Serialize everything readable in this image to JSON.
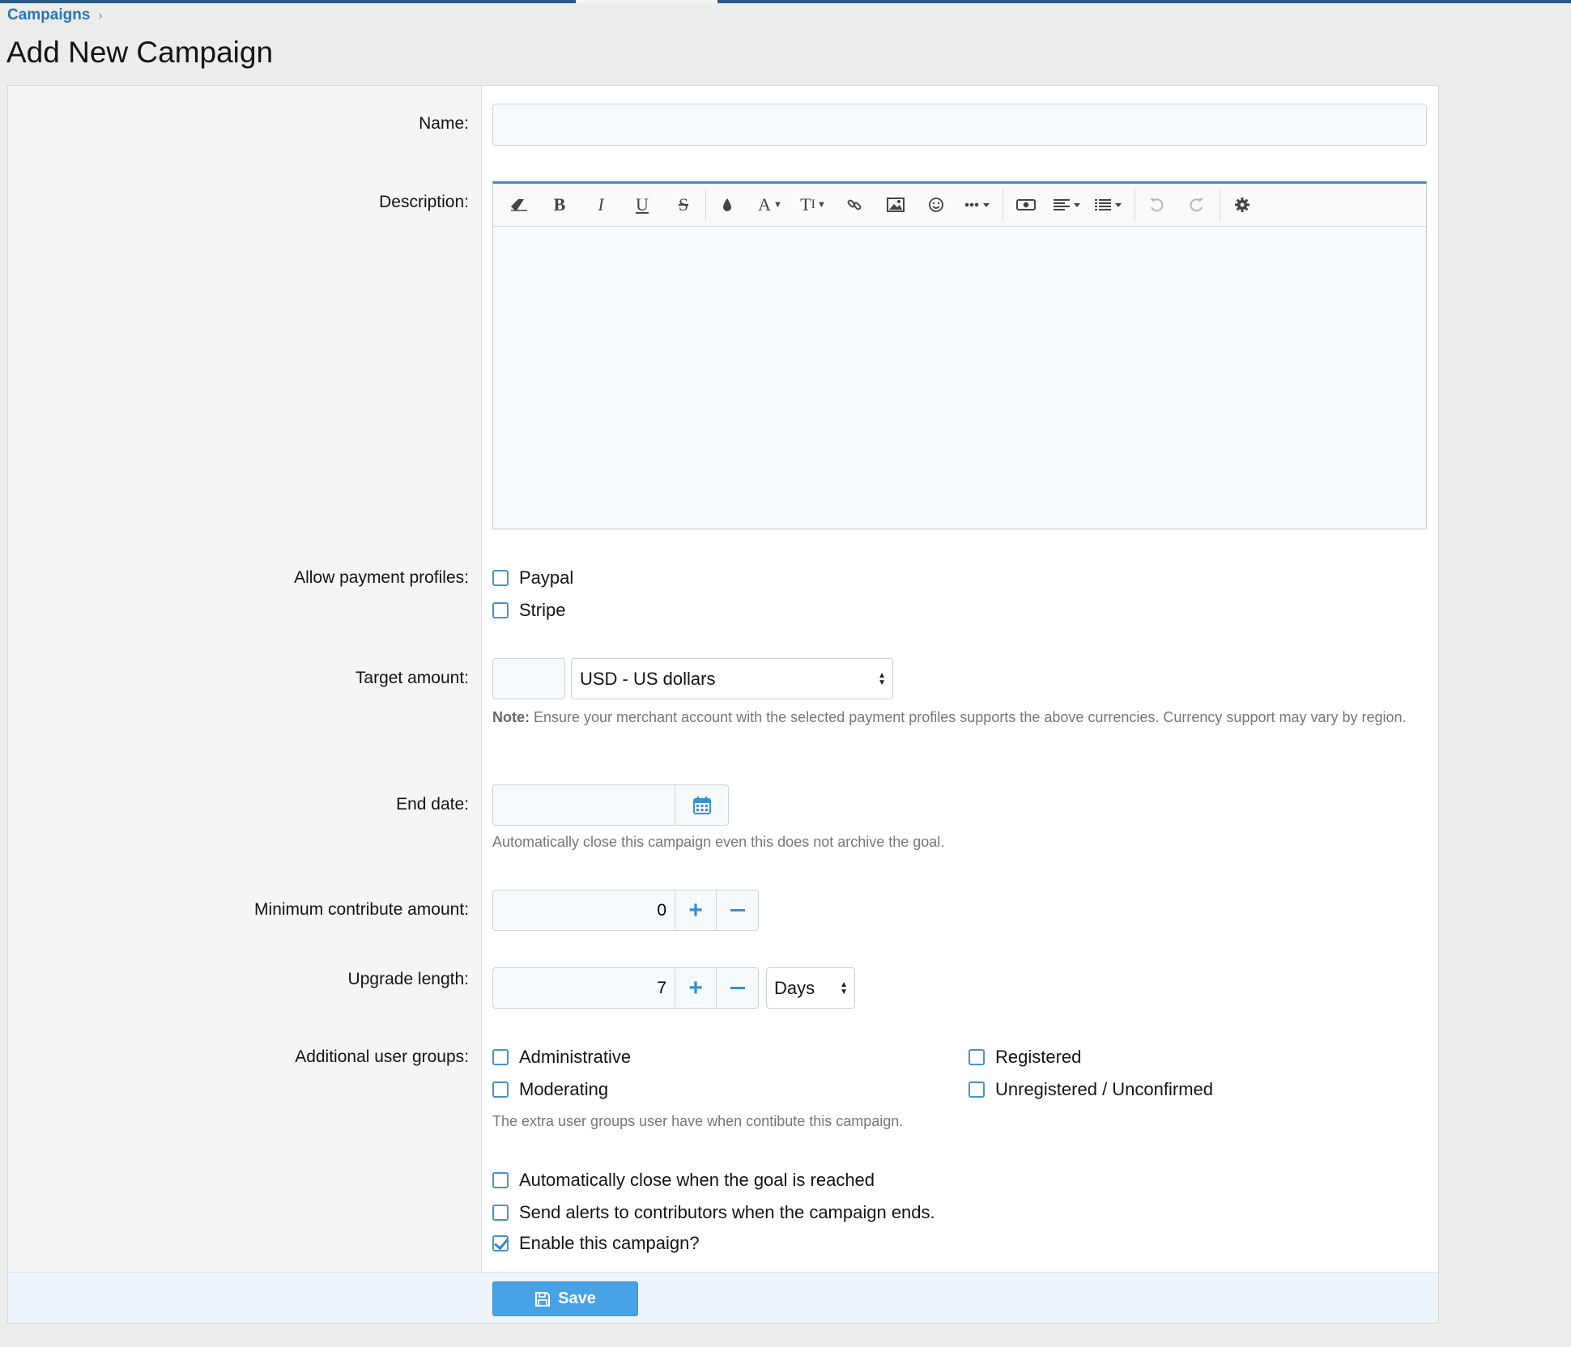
{
  "breadcrumb": {
    "item": "Campaigns"
  },
  "page": {
    "title": "Add New Campaign"
  },
  "form": {
    "name": {
      "label": "Name:",
      "value": ""
    },
    "description": {
      "label": "Description:"
    },
    "payment": {
      "label": "Allow payment profiles:",
      "options": [
        "Paypal",
        "Stripe"
      ],
      "checked": [
        false,
        false
      ]
    },
    "target": {
      "label": "Target amount:",
      "value": "",
      "currency": "USD - US dollars",
      "note_bold": "Note:",
      "note": " Ensure your merchant account with the selected payment profiles supports the above currencies. Currency support may vary by region."
    },
    "end_date": {
      "label": "End date:",
      "value": "",
      "hint": "Automatically close this campaign even this does not archive the goal."
    },
    "min_amount": {
      "label": "Minimum contribute amount:",
      "value": "0"
    },
    "upgrade": {
      "label": "Upgrade length:",
      "value": "7",
      "unit": "Days"
    },
    "groups": {
      "label": "Additional user groups:",
      "options": [
        "Administrative",
        "Moderating",
        "Registered",
        "Unregistered / Unconfirmed"
      ],
      "hint": "The extra user groups user have when contibute this campaign."
    },
    "options": {
      "auto_close": {
        "label": "Automatically close when the goal is reached",
        "checked": false
      },
      "send_alerts": {
        "label": "Send alerts to contributors when the campaign ends.",
        "checked": false
      },
      "enable": {
        "label": "Enable this campaign?",
        "checked": true
      }
    }
  },
  "actions": {
    "save": "Save"
  },
  "theme": {
    "accent": "#3d8ed0",
    "link": "#2577b1",
    "button": "#47a3e6"
  }
}
